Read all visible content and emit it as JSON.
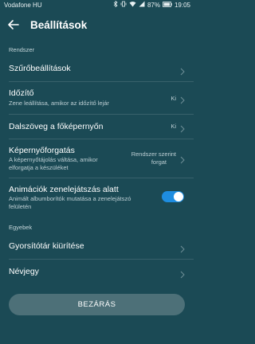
{
  "status": {
    "carrier": "Vodafone HU",
    "battery": "87%",
    "time": "19:05",
    "icons": [
      "bluetooth-icon",
      "vibrate-icon",
      "wifi-icon",
      "signal-icon",
      "battery-icon"
    ]
  },
  "header": {
    "title": "Beállítások",
    "back_icon": "arrow-left-icon"
  },
  "sections": {
    "rendszer": "Rendszer",
    "egyebek": "Egyebek"
  },
  "items": {
    "szuro": {
      "title": "Szűrőbeállítások"
    },
    "idozito": {
      "title": "Időzítő",
      "subtitle": "Zene leállítása, amikor az időzítő lejár",
      "value": "Ki"
    },
    "dalszoveg": {
      "title": "Dalszöveg a főképernyőn",
      "value": "Ki"
    },
    "kepernyo": {
      "title": "Képernyőforgatás",
      "subtitle_line1": "A képernyőtájolás váltása, amikor",
      "subtitle_line2": "elforgatja a készüléket",
      "value_line1": "Rendszer szerint",
      "value_line2": "forgat"
    },
    "animaciok": {
      "title": "Animációk zenelejátszás alatt",
      "subtitle_line1": "Animált albumborítók mutatása a zenelejátszó",
      "subtitle_line2": "felületén",
      "enabled": true
    },
    "gyorsitotar": {
      "title": "Gyorsítótár kiürítése"
    },
    "nevjegy": {
      "title": "Névjegy"
    }
  },
  "footer": {
    "close_label": "BEZÁRÁS"
  },
  "colors": {
    "background": "#1b4a55",
    "toggle_on": "#1e8de0",
    "button": "#4d7078"
  }
}
